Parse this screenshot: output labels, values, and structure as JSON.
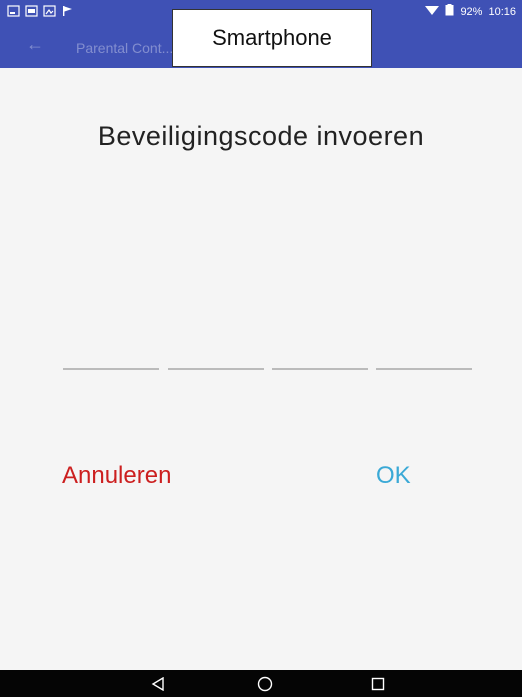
{
  "callout": {
    "label": "Smartphone"
  },
  "status_bar": {
    "left_icons": [
      "screenshot-icon",
      "video-icon",
      "image-icon",
      "flag-icon"
    ],
    "battery": "92%",
    "time": "10:16",
    "wifi_icon": "wifi-icon",
    "battery_icon": "battery-icon"
  },
  "app_bar": {
    "back_icon": "back-arrow-icon",
    "title": "Parental Cont..."
  },
  "main": {
    "title": "Beveiligingscode invoeren",
    "code_slots": [
      "",
      "",
      "",
      ""
    ],
    "cancel_label": "Annuleren",
    "ok_label": "OK"
  },
  "nav_bar": {
    "back": "back-triangle-icon",
    "home": "home-circle-icon",
    "recents": "recents-square-icon"
  },
  "colors": {
    "app_bar": "#3f51b5",
    "cancel": "#cc1f1f",
    "ok": "#3aa9d6",
    "nav_bar": "#050505"
  }
}
